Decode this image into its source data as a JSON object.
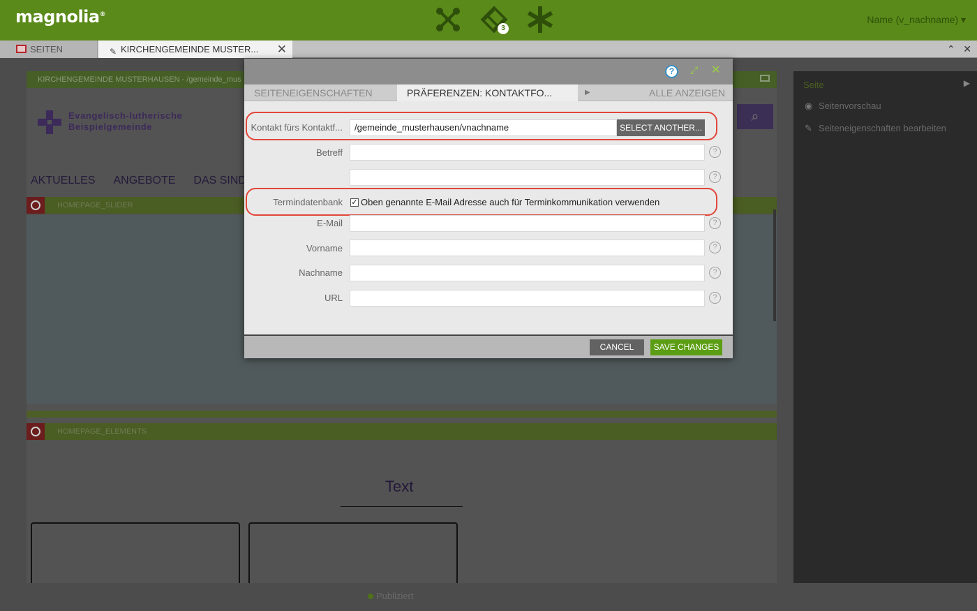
{
  "app": {
    "logo_text": "magnolia",
    "logo_mark": "®",
    "notification_count": "3",
    "user_menu": "Name (v_nachname) ▾"
  },
  "tabs": {
    "seiten_label": "SEITEN",
    "editor_label": "KIRCHENGEMEINDE MUSTER..."
  },
  "background_page": {
    "page_path": "KIRCHENGEMEINDE MUSTERHAUSEN - /gemeinde_mus",
    "org_name_line1": "Evangelisch-lutherische",
    "org_name_line2": "Beispielgemeinde",
    "nav": [
      "AKTUELLES",
      "ANGEBOTE",
      "DAS SIND W"
    ],
    "area_slider": "HOMEPAGE_SLIDER",
    "area_elements": "HOMEPAGE_ELEMENTS",
    "text_heading": "Text",
    "status": "Publiziert"
  },
  "side_panel": {
    "title": "Seite",
    "items": [
      "Seitenvorschau",
      "Seiteneigenschaften bearbeiten"
    ]
  },
  "dialog": {
    "tabs": [
      "SEITENEIGENSCHAFTEN",
      "PRÄFERENZEN: KONTAKTFO...",
      "ALLE ANZEIGEN"
    ],
    "fields": {
      "kontakt_label": "Kontakt fürs Kontaktf...",
      "kontakt_value": "/gemeinde_musterhausen/vnachname",
      "select_another": "SELECT ANOTHER...",
      "betreff_label": "Betreff",
      "betreff_value": "",
      "unlabeled_value": "",
      "termin_label": "Termindatenbank",
      "termin_checkbox_label": "Oben genannte E-Mail Adresse auch für Terminkommunikation verwenden",
      "termin_checked": true,
      "email_label": "E-Mail",
      "email_value": "",
      "vorname_label": "Vorname",
      "vorname_value": "",
      "nachname_label": "Nachname",
      "nachname_value": "",
      "url_label": "URL",
      "url_value": ""
    },
    "cancel_label": "CANCEL",
    "save_label": "SAVE CHANGES"
  },
  "colors": {
    "brand_green": "#5a8a1a",
    "save_green": "#5c9e13",
    "highlight_red": "#e2473a"
  }
}
